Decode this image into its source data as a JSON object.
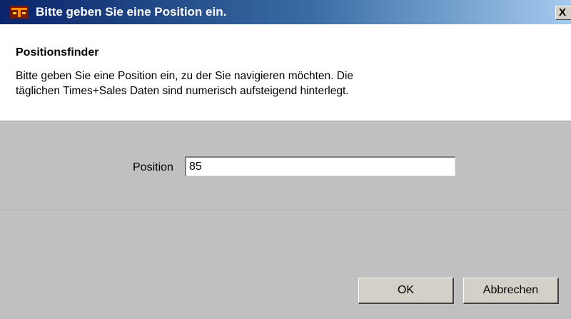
{
  "window": {
    "title": "Bitte geben Sie eine Position ein.",
    "close_glyph": "X"
  },
  "header": {
    "title": "Positionsfinder",
    "description_lines": [
      "Bitte geben Sie eine Position ein, zu der Sie navigieren möchten. Die",
      "täglichen Times+Sales Daten sind numerisch aufsteigend hinterlegt."
    ]
  },
  "form": {
    "position_label": "Position",
    "position_value": "85"
  },
  "buttons": {
    "ok_label": "OK",
    "cancel_label": "Abbrechen"
  },
  "icons": {
    "app_icon": "app-logo-icon",
    "close_icon": "close-icon"
  },
  "colors": {
    "titlebar_start": "#0a246a",
    "titlebar_end": "#a6caf0",
    "dialog_background": "#c0c0c0",
    "header_background": "#ffffff",
    "app_icon_orange": "#ff8c00"
  }
}
